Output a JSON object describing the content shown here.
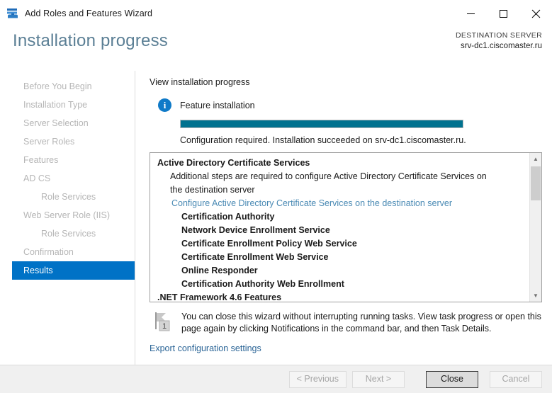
{
  "window": {
    "title": "Add Roles and Features Wizard",
    "icon": "server-tools-icon",
    "controls": {
      "minimize": "Minimize",
      "maximize": "Maximize",
      "close": "Close"
    }
  },
  "header": {
    "page_title": "Installation progress",
    "destination_label": "DESTINATION SERVER",
    "destination_server": "srv-dc1.ciscomaster.ru"
  },
  "sidebar": {
    "items": [
      {
        "label": "Before You Begin",
        "sub": false,
        "active": false
      },
      {
        "label": "Installation Type",
        "sub": false,
        "active": false
      },
      {
        "label": "Server Selection",
        "sub": false,
        "active": false
      },
      {
        "label": "Server Roles",
        "sub": false,
        "active": false
      },
      {
        "label": "Features",
        "sub": false,
        "active": false
      },
      {
        "label": "AD CS",
        "sub": false,
        "active": false
      },
      {
        "label": "Role Services",
        "sub": true,
        "active": false
      },
      {
        "label": "Web Server Role (IIS)",
        "sub": false,
        "active": false
      },
      {
        "label": "Role Services",
        "sub": true,
        "active": false
      },
      {
        "label": "Confirmation",
        "sub": false,
        "active": false
      },
      {
        "label": "Results",
        "sub": false,
        "active": true
      }
    ]
  },
  "main": {
    "view_label": "View installation progress",
    "feature_label": "Feature installation",
    "progress_percent": 100,
    "progress_status": "Configuration required. Installation succeeded on srv-dc1.ciscomaster.ru.",
    "results": [
      {
        "text": "Active Directory Certificate Services",
        "style": "head"
      },
      {
        "text": "Additional steps are required to configure Active Directory Certificate Services on the destination server",
        "style": "wrap"
      },
      {
        "text": "Configure Active Directory Certificate Services on the destination server",
        "style": "link"
      },
      {
        "text": "Certification Authority",
        "style": "child"
      },
      {
        "text": "Network Device Enrollment Service",
        "style": "child"
      },
      {
        "text": "Certificate Enrollment Policy Web Service",
        "style": "child"
      },
      {
        "text": "Certificate Enrollment Web Service",
        "style": "child"
      },
      {
        "text": "Online Responder",
        "style": "child"
      },
      {
        "text": "Certification Authority Web Enrollment",
        "style": "child"
      },
      {
        "text": ".NET Framework 4.6 Features",
        "style": "head"
      }
    ],
    "notice_text": "You can close this wizard without interrupting running tasks. View task progress or open this page again by clicking Notifications in the command bar, and then Task Details.",
    "notice_badge": "1",
    "export_link": "Export configuration settings"
  },
  "footer": {
    "previous": "< Previous",
    "next": "Next >",
    "close": "Close",
    "cancel": "Cancel"
  },
  "colors": {
    "accent_blue": "#0072c6",
    "progress_teal": "#00728f",
    "title_blue_gray": "#5b7f95",
    "link_blue": "#2a6496"
  }
}
